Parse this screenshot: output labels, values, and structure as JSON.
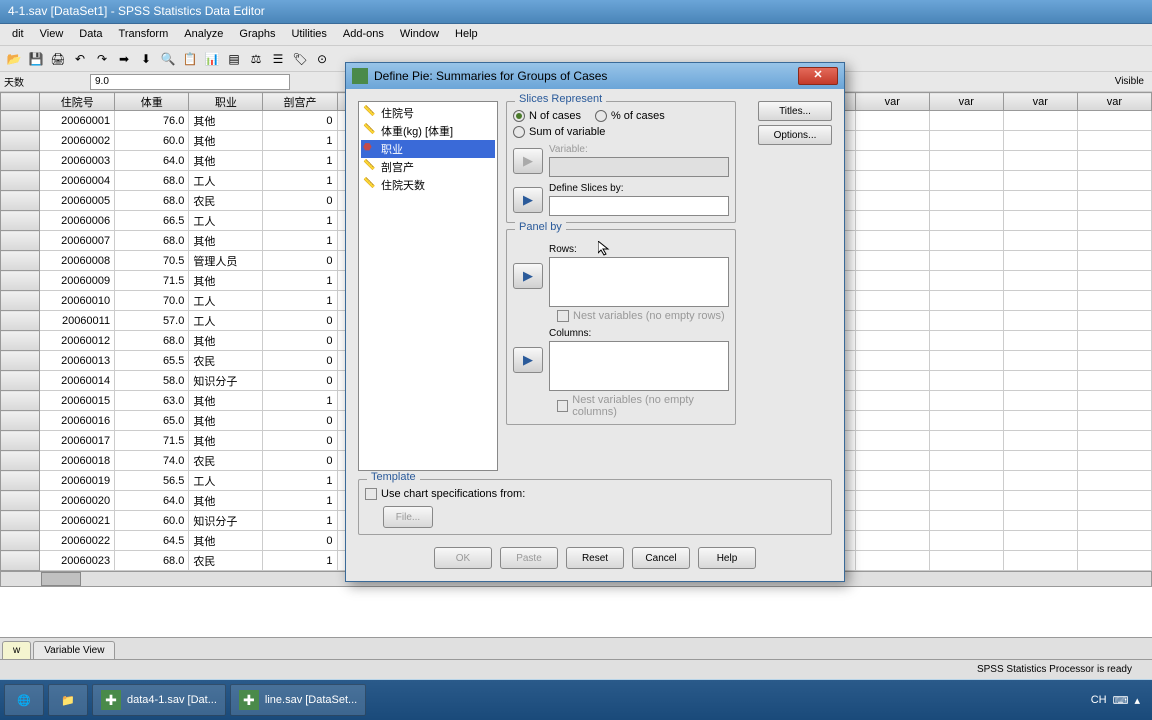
{
  "titlebar": "4-1.sav [DataSet1] - SPSS Statistics Data Editor",
  "menu": {
    "edit": "dit",
    "view": "View",
    "data": "Data",
    "transform": "Transform",
    "analyze": "Analyze",
    "graphs": "Graphs",
    "utilities": "Utilities",
    "addons": "Add-ons",
    "window": "Window",
    "help": "Help"
  },
  "cell": {
    "label": "天数",
    "value": "9.0",
    "visible": "Visible"
  },
  "cols": {
    "c1": "住院号",
    "c2": "体重",
    "c3": "职业",
    "c4": "剖宫产",
    "var": "var"
  },
  "rows": [
    {
      "n": "",
      "id": "20060001",
      "w": "76.0",
      "occ": "其他",
      "c": "0"
    },
    {
      "n": "",
      "id": "20060002",
      "w": "60.0",
      "occ": "其他",
      "c": "1"
    },
    {
      "n": "",
      "id": "20060003",
      "w": "64.0",
      "occ": "其他",
      "c": "1"
    },
    {
      "n": "",
      "id": "20060004",
      "w": "68.0",
      "occ": "工人",
      "c": "1"
    },
    {
      "n": "",
      "id": "20060005",
      "w": "68.0",
      "occ": "农民",
      "c": "0"
    },
    {
      "n": "",
      "id": "20060006",
      "w": "66.5",
      "occ": "工人",
      "c": "1"
    },
    {
      "n": "",
      "id": "20060007",
      "w": "68.0",
      "occ": "其他",
      "c": "1"
    },
    {
      "n": "",
      "id": "20060008",
      "w": "70.5",
      "occ": "管理人员",
      "c": "0"
    },
    {
      "n": "",
      "id": "20060009",
      "w": "71.5",
      "occ": "其他",
      "c": "1"
    },
    {
      "n": "",
      "id": "20060010",
      "w": "70.0",
      "occ": "工人",
      "c": "1"
    },
    {
      "n": "",
      "id": "20060011",
      "w": "57.0",
      "occ": "工人",
      "c": "0"
    },
    {
      "n": "",
      "id": "20060012",
      "w": "68.0",
      "occ": "其他",
      "c": "0"
    },
    {
      "n": "",
      "id": "20060013",
      "w": "65.5",
      "occ": "农民",
      "c": "0"
    },
    {
      "n": "",
      "id": "20060014",
      "w": "58.0",
      "occ": "知识分子",
      "c": "0"
    },
    {
      "n": "",
      "id": "20060015",
      "w": "63.0",
      "occ": "其他",
      "c": "1"
    },
    {
      "n": "",
      "id": "20060016",
      "w": "65.0",
      "occ": "其他",
      "c": "0"
    },
    {
      "n": "",
      "id": "20060017",
      "w": "71.5",
      "occ": "其他",
      "c": "0"
    },
    {
      "n": "",
      "id": "20060018",
      "w": "74.0",
      "occ": "农民",
      "c": "0"
    },
    {
      "n": "",
      "id": "20060019",
      "w": "56.5",
      "occ": "工人",
      "c": "1"
    },
    {
      "n": "",
      "id": "20060020",
      "w": "64.0",
      "occ": "其他",
      "c": "1"
    },
    {
      "n": "",
      "id": "20060021",
      "w": "60.0",
      "occ": "知识分子",
      "c": "1"
    },
    {
      "n": "",
      "id": "20060022",
      "w": "64.5",
      "occ": "其他",
      "c": "0"
    },
    {
      "n": "",
      "id": "20060023",
      "w": "68.0",
      "occ": "农民",
      "c": "1"
    }
  ],
  "tab1": "w",
  "tab2": "Variable View",
  "status": "SPSS Statistics Processor is ready",
  "task1": "data4-1.sav [Dat...",
  "task2": "line.sav [DataSet...",
  "tray": {
    "lang": "CH"
  },
  "dialog": {
    "title": "Define Pie: Summaries for Groups of Cases",
    "vars": {
      "v1": "住院号",
      "v2": "体重(kg) [体重]",
      "v3": "职业",
      "v4": "剖宫产",
      "v5": "住院天数"
    },
    "slices": {
      "title": "Slices Represent",
      "r1": "N of cases",
      "r2": "% of cases",
      "r3": "Sum of variable",
      "varlabel": "Variable:",
      "slicelabel": "Define Slices by:"
    },
    "panel": {
      "title": "Panel by",
      "rows": "Rows:",
      "nest1": "Nest variables (no empty rows)",
      "cols": "Columns:",
      "nest2": "Nest variables (no empty columns)"
    },
    "tmpl": {
      "title": "Template",
      "use": "Use chart specifications from:",
      "file": "File..."
    },
    "side": {
      "titles": "Titles...",
      "options": "Options..."
    },
    "btns": {
      "ok": "OK",
      "paste": "Paste",
      "reset": "Reset",
      "cancel": "Cancel",
      "help": "Help"
    }
  }
}
